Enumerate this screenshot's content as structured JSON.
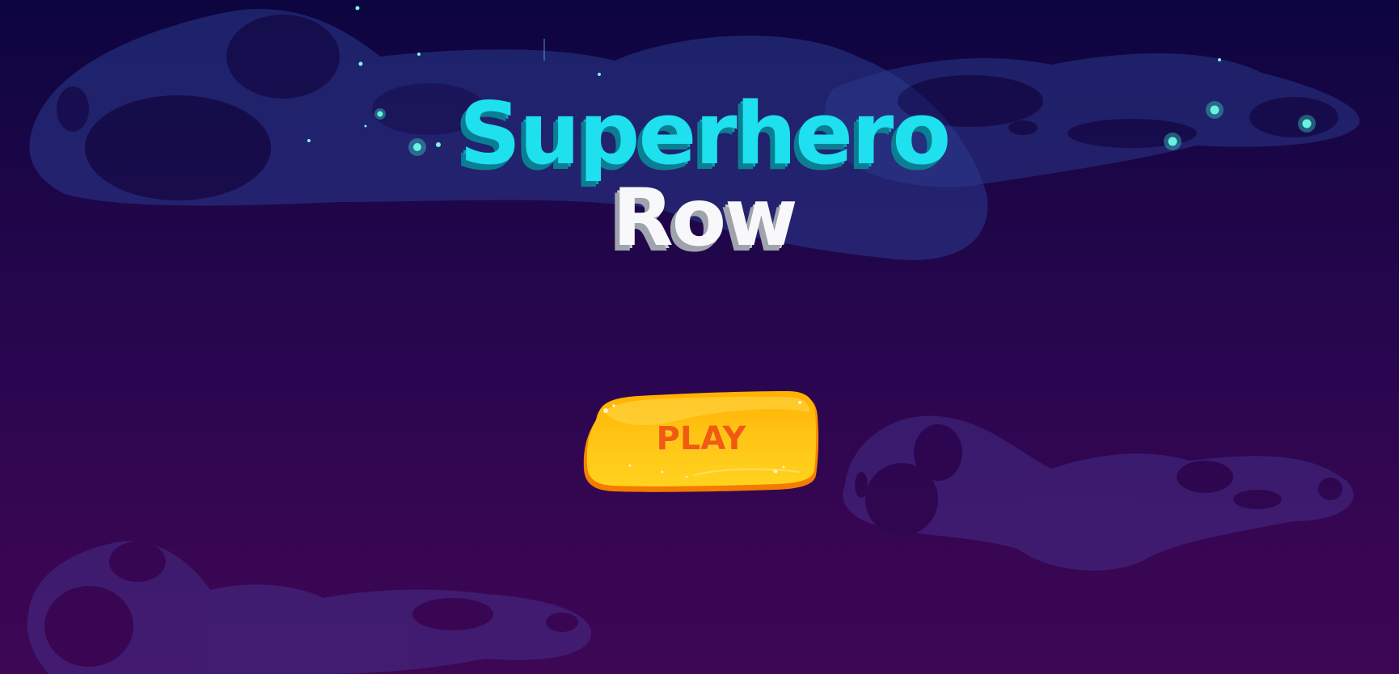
{
  "game": {
    "title_line1": "Superhero",
    "title_line2": "Row",
    "play_label": "PLAY"
  },
  "colors": {
    "title_primary": "#1ee0ee",
    "title_secondary": "#f8f8fb",
    "button_fill": "#ffc11a",
    "button_text": "#f25a12",
    "background_top": "#0c0540",
    "background_bottom": "#3d0755"
  }
}
